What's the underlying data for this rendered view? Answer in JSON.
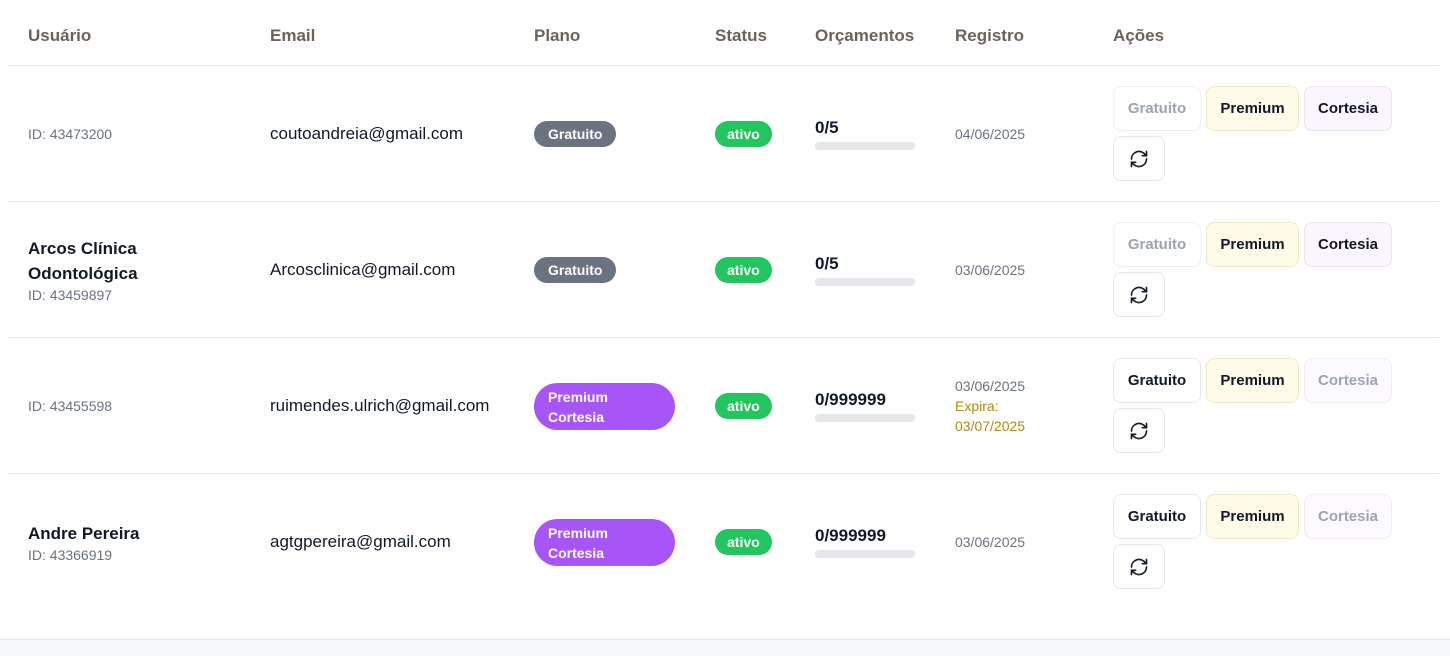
{
  "header": {
    "usuario": "Usuário",
    "email": "Email",
    "plano": "Plano",
    "status": "Status",
    "orcamentos": "Orçamentos",
    "registro": "Registro",
    "acoes": "Ações"
  },
  "rows": [
    {
      "name": "",
      "id": "ID: 43473200",
      "email": "coutoandreia@gmail.com",
      "plan": "Gratuito",
      "status": "ativo",
      "quota": "0/5",
      "quota_fraction": 0,
      "registered": "04/06/2025",
      "expira_label": "",
      "expira_date": "",
      "actions": {
        "free": "Gratuito",
        "premium": "Premium",
        "cortesia": "Cortesia",
        "refresh_icon": "refresh-icon"
      }
    },
    {
      "name": "Arcos Clínica Odontológica",
      "id": "ID: 43459897",
      "email": "Arcosclinica@gmail.com",
      "plan": "Gratuito",
      "status": "ativo",
      "quota": "0/5",
      "quota_fraction": 0,
      "registered": "03/06/2025",
      "expira_label": "",
      "expira_date": "",
      "actions": {
        "free": "Gratuito",
        "premium": "Premium",
        "cortesia": "Cortesia",
        "refresh_icon": "refresh-icon"
      }
    },
    {
      "name": "",
      "id": "ID: 43455598",
      "email": "ruimendes.ulrich@gmail.com",
      "plan": "Premium Cortesia",
      "status": "ativo",
      "quota": "0/999999",
      "quota_fraction": 0,
      "registered": "03/06/2025",
      "expira_label": "Expira:",
      "expira_date": "03/07/2025",
      "actions": {
        "free": "Gratuito",
        "premium": "Premium",
        "cortesia": "Cortesia",
        "refresh_icon": "refresh-icon"
      }
    },
    {
      "name": "Andre Pereira",
      "id": "ID: 43366919",
      "email": "agtgpereira@gmail.com",
      "plan": "Premium Cortesia",
      "status": "ativo",
      "quota": "0/999999",
      "quota_fraction": 0,
      "registered": "03/06/2025",
      "expira_label": "",
      "expira_date": "",
      "actions": {
        "free": "Gratuito",
        "premium": "Premium",
        "cortesia": "Cortesia",
        "refresh_icon": "refresh-icon"
      }
    }
  ],
  "colors": {
    "free_badge": "#6b7280",
    "premium_badge": "#a855f7",
    "status_active": "#22c55e",
    "expira": "#b8860b",
    "premium_button_bg": "#fefce8",
    "cortesia_button_bg": "#faf5ff"
  }
}
